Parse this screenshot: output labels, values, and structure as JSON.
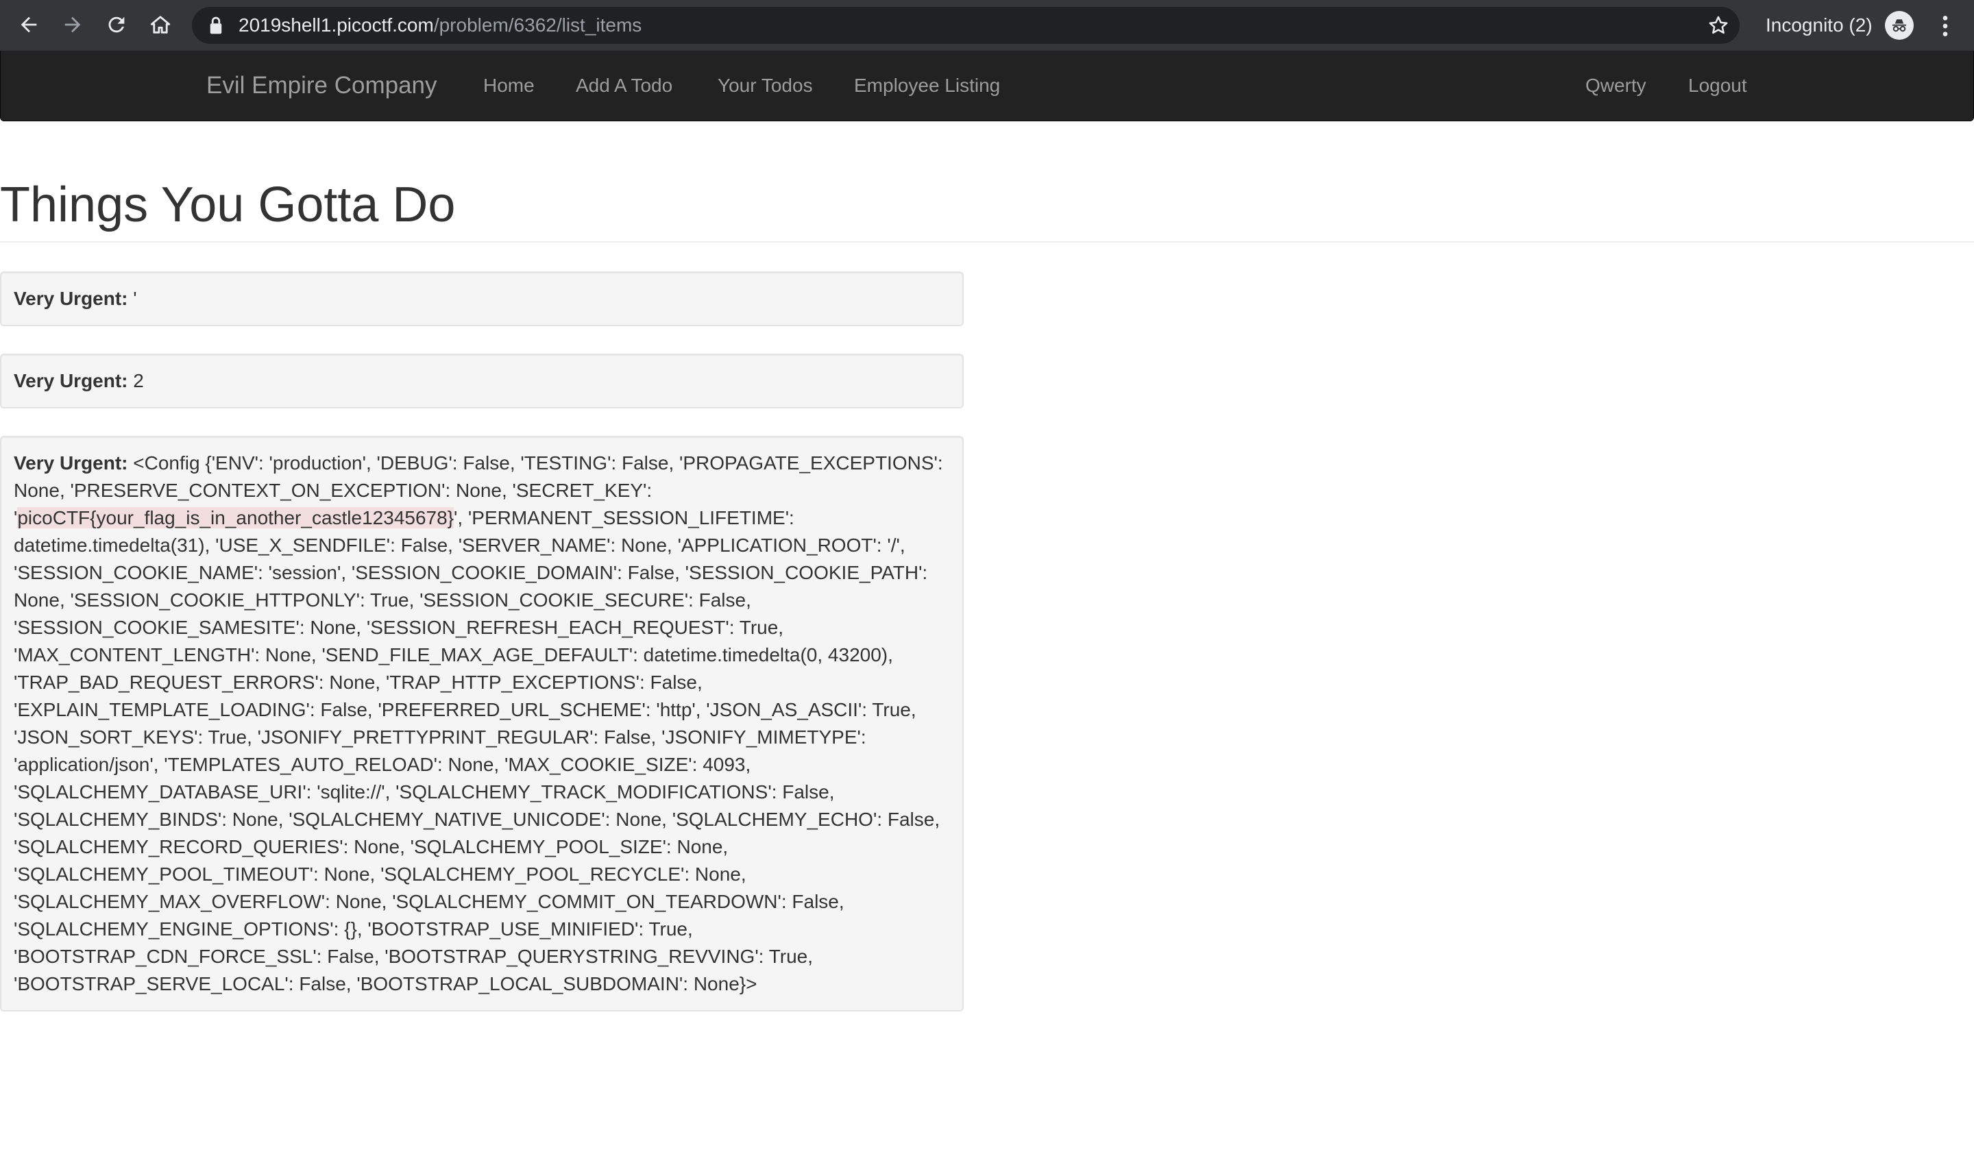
{
  "browser": {
    "url_host": "2019shell1.picoctf.com",
    "url_path": "/problem/6362/list_items",
    "incognito_label": "Incognito (2)"
  },
  "navbar": {
    "brand": "Evil Empire Company",
    "links": [
      "Home",
      "Add A Todo",
      "Your Todos",
      "Employee Listing"
    ],
    "right_links": [
      "Qwerty",
      "Logout"
    ]
  },
  "page": {
    "title": "Things You Gotta Do"
  },
  "todos": [
    {
      "label": "Very Urgent:",
      "text": "'"
    },
    {
      "label": "Very Urgent:",
      "text": "2"
    },
    {
      "label": "Very Urgent:",
      "text_before": "<Config {'ENV': 'production', 'DEBUG': False, 'TESTING': False, 'PROPAGATE_EXCEPTIONS': None, 'PRESERVE_CONTEXT_ON_EXCEPTION': None, 'SECRET_KEY': '",
      "highlight": "picoCTF{your_flag_is_in_another_castle12345678}",
      "text_after": "', 'PERMANENT_SESSION_LIFETIME': datetime.timedelta(31), 'USE_X_SENDFILE': False, 'SERVER_NAME': None, 'APPLICATION_ROOT': '/', 'SESSION_COOKIE_NAME': 'session', 'SESSION_COOKIE_DOMAIN': False, 'SESSION_COOKIE_PATH': None, 'SESSION_COOKIE_HTTPONLY': True, 'SESSION_COOKIE_SECURE': False, 'SESSION_COOKIE_SAMESITE': None, 'SESSION_REFRESH_EACH_REQUEST': True, 'MAX_CONTENT_LENGTH': None, 'SEND_FILE_MAX_AGE_DEFAULT': datetime.timedelta(0, 43200), 'TRAP_BAD_REQUEST_ERRORS': None, 'TRAP_HTTP_EXCEPTIONS': False, 'EXPLAIN_TEMPLATE_LOADING': False, 'PREFERRED_URL_SCHEME': 'http', 'JSON_AS_ASCII': True, 'JSON_SORT_KEYS': True, 'JSONIFY_PRETTYPRINT_REGULAR': False, 'JSONIFY_MIMETYPE': 'application/json', 'TEMPLATES_AUTO_RELOAD': None, 'MAX_COOKIE_SIZE': 4093, 'SQLALCHEMY_DATABASE_URI': 'sqlite://', 'SQLALCHEMY_TRACK_MODIFICATIONS': False, 'SQLALCHEMY_BINDS': None, 'SQLALCHEMY_NATIVE_UNICODE': None, 'SQLALCHEMY_ECHO': False, 'SQLALCHEMY_RECORD_QUERIES': None, 'SQLALCHEMY_POOL_SIZE': None, 'SQLALCHEMY_POOL_TIMEOUT': None, 'SQLALCHEMY_POOL_RECYCLE': None, 'SQLALCHEMY_MAX_OVERFLOW': None, 'SQLALCHEMY_COMMIT_ON_TEARDOWN': False, 'SQLALCHEMY_ENGINE_OPTIONS': {}, 'BOOTSTRAP_USE_MINIFIED': True, 'BOOTSTRAP_CDN_FORCE_SSL': False, 'BOOTSTRAP_QUERYSTRING_REVVING': True, 'BOOTSTRAP_SERVE_LOCAL': False, 'BOOTSTRAP_LOCAL_SUBDOMAIN': None}>"
    }
  ],
  "colors": {
    "chrome_bg": "#35363a",
    "omnibox_bg": "#202124",
    "navbar_bg": "#222222",
    "nav_text": "#9d9d9d",
    "well_bg": "#f5f5f5",
    "flag_highlight": "#f2dede"
  }
}
